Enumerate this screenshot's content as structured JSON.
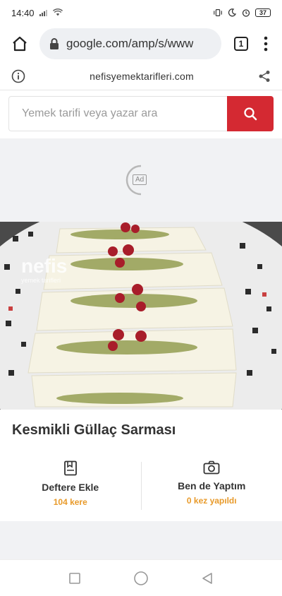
{
  "status_bar": {
    "time": "14:40",
    "battery": "37",
    "icons": [
      "signal-icon",
      "wifi-icon",
      "vibrate-icon",
      "moon-icon",
      "alarm-icon",
      "battery-icon"
    ]
  },
  "browser": {
    "url": "google.com/amp/s/www",
    "tab_count": "1"
  },
  "amp_header": {
    "domain": "nefisyemektarifleri.com"
  },
  "search": {
    "placeholder": "Yemek tarifi veya yazar ara"
  },
  "ad": {
    "label": "Ad"
  },
  "image": {
    "watermark_main": "nefis",
    "watermark_sub": "yemek tarifleri"
  },
  "recipe": {
    "title": "Kesmikli Güllaç Sarması"
  },
  "actions": [
    {
      "label": "Deftere Ekle",
      "count": "104 kere",
      "icon": "notebook-icon"
    },
    {
      "label": "Ben de Yaptım",
      "count": "0 kez yapıldı",
      "icon": "camera-icon"
    }
  ],
  "colors": {
    "accent_red": "#d42932",
    "count_orange": "#e89a2a",
    "gray_band": "#f1f2f4"
  }
}
